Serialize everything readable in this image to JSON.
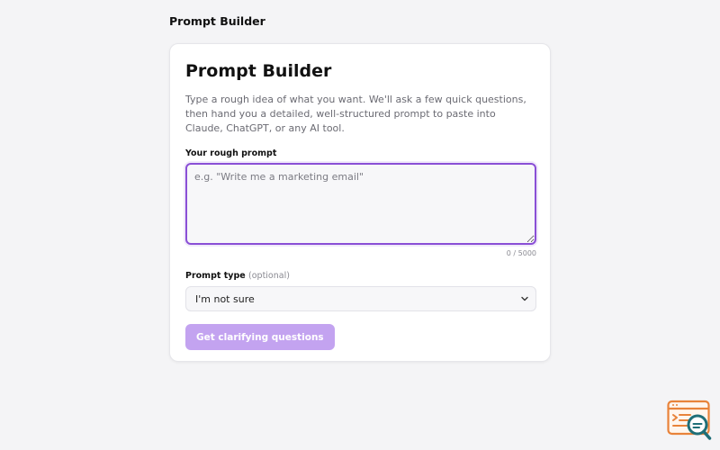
{
  "header": {
    "title": "Prompt Builder"
  },
  "card": {
    "title": "Prompt Builder",
    "description": "Type a rough idea of what you want. We'll ask a few quick questions, then hand you a detailed, well-structured prompt to paste into Claude, ChatGPT, or any AI tool."
  },
  "prompt_field": {
    "label": "Your rough prompt",
    "value": "",
    "placeholder": "e.g. \"Write me a marketing email\"",
    "char_count": "0 / 5000"
  },
  "type_field": {
    "label": "Prompt type",
    "optional_label": "(optional)",
    "selected": "I'm not sure"
  },
  "submit": {
    "label": "Get clarifying questions"
  },
  "colors": {
    "accent": "#8a4fd6",
    "button_disabled": "#c3a3f0",
    "logo_orange": "#e8833a",
    "logo_teal": "#1f6f78"
  },
  "icons": {
    "select_chevron": "chevron-down-icon",
    "corner_logo": "search-document-logo-icon"
  }
}
